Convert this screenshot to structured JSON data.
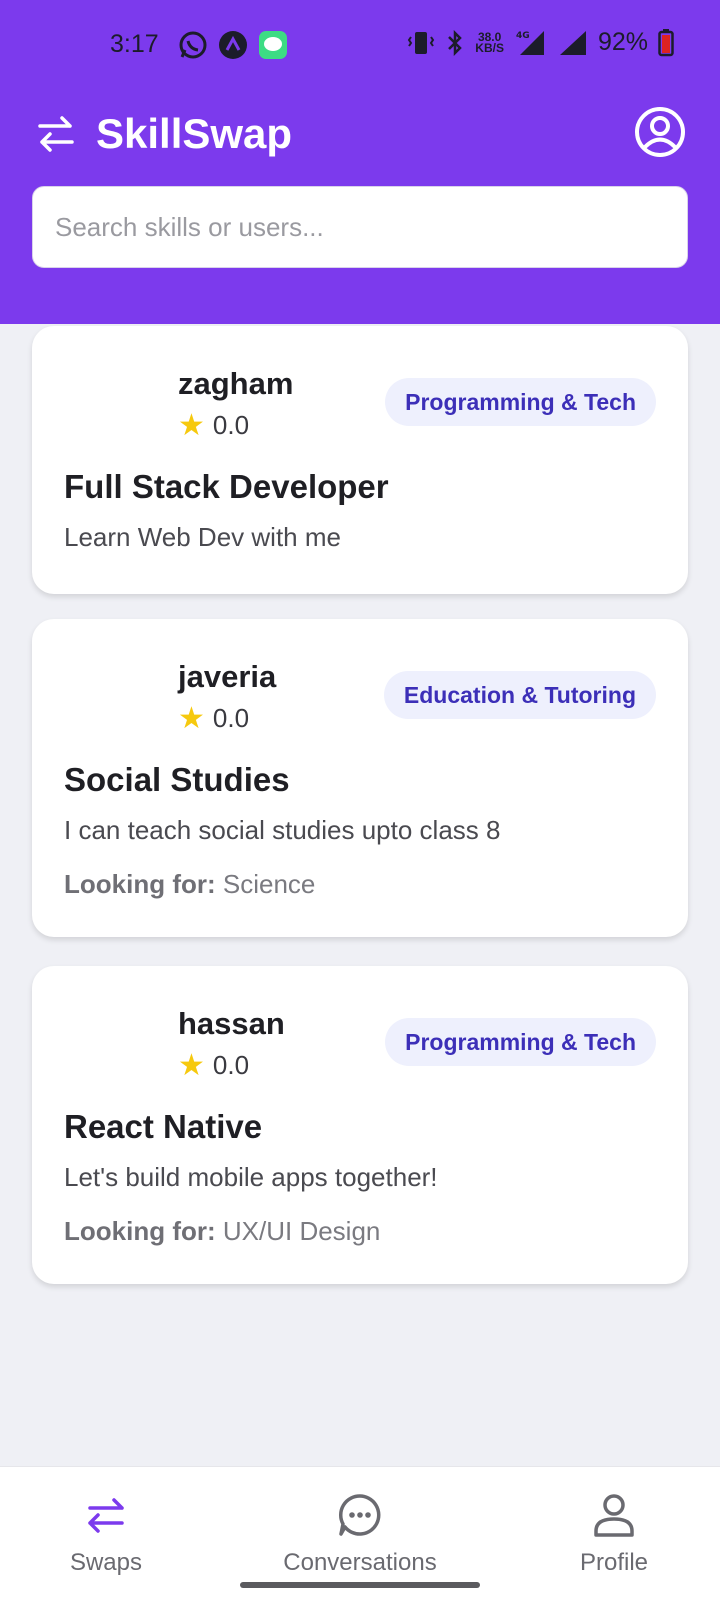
{
  "status_bar": {
    "time": "3:17",
    "net_speed_top": "38.0",
    "net_speed_bottom": "KB/S",
    "network_type": "4G",
    "battery": "92%"
  },
  "header": {
    "title": "SkillSwap",
    "brand_color": "#7c3aed"
  },
  "search": {
    "placeholder": "Search skills or users..."
  },
  "cards": [
    {
      "username": "zagham",
      "rating": "0.0",
      "category": "Programming & Tech",
      "title": "Full Stack Developer",
      "description": "Learn Web Dev with me"
    },
    {
      "username": "javeria",
      "rating": "0.0",
      "category": "Education & Tutoring",
      "title": "Social Studies",
      "description": "I can teach social studies upto class 8",
      "looking_label": "Looking for:",
      "looking_value": "Science"
    },
    {
      "username": "hassan",
      "rating": "0.0",
      "category": "Programming & Tech",
      "title": "React Native",
      "description": "Let's build mobile apps together!",
      "looking_label": "Looking for:",
      "looking_value": "UX/UI Design"
    }
  ],
  "bottom_nav": {
    "items": [
      {
        "label": "Swaps",
        "icon": "swap-icon",
        "active": true
      },
      {
        "label": "Conversations",
        "icon": "chat-icon",
        "active": false
      },
      {
        "label": "Profile",
        "icon": "person-icon",
        "active": false
      }
    ]
  }
}
